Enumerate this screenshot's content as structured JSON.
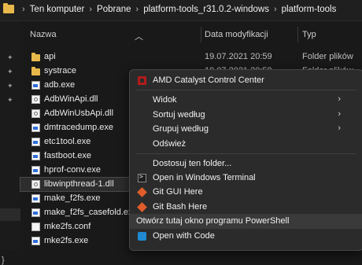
{
  "breadcrumb": [
    "Ten komputer",
    "Pobrane",
    "platform-tools_r31.0.2-windows",
    "platform-tools"
  ],
  "columns": {
    "name": "Nazwa",
    "date": "Data modyfikacji",
    "type": "Typ"
  },
  "files": [
    {
      "name": "api",
      "date": "19.07.2021 20:59",
      "type": "Folder plików",
      "icon": "folder"
    },
    {
      "name": "systrace",
      "date": "19.07.2021 20:59",
      "type": "Folder plików",
      "icon": "folder"
    },
    {
      "name": "adb.exe",
      "date": "",
      "type": "",
      "icon": "exe"
    },
    {
      "name": "AdbWinApi.dll",
      "date": "",
      "type": "apl",
      "icon": "dll"
    },
    {
      "name": "AdbWinUsbApi.dll",
      "date": "",
      "type": "apl",
      "icon": "dll"
    },
    {
      "name": "dmtracedump.exe",
      "date": "",
      "type": "",
      "icon": "exe"
    },
    {
      "name": "etc1tool.exe",
      "date": "",
      "type": "",
      "icon": "exe"
    },
    {
      "name": "fastboot.exe",
      "date": "",
      "type": "",
      "icon": "exe"
    },
    {
      "name": "hprof-conv.exe",
      "date": "",
      "type": "",
      "icon": "exe"
    },
    {
      "name": "libwinpthread-1.dll",
      "date": "",
      "type": "apl",
      "icon": "dll",
      "selected": true
    },
    {
      "name": "make_f2fs.exe",
      "date": "",
      "type": "",
      "icon": "exe"
    },
    {
      "name": "make_f2fs_casefold.exe",
      "date": "",
      "type": "",
      "icon": "exe"
    },
    {
      "name": "mke2fs.conf",
      "date": "",
      "type": "",
      "icon": "conf"
    },
    {
      "name": "mke2fs.exe",
      "date": "",
      "type": "",
      "icon": "exe"
    }
  ],
  "context_menu": {
    "amd": "AMD Catalyst Control Center",
    "view": "Widok",
    "sort": "Sortuj według",
    "group": "Grupuj według",
    "refresh": "Odśwież",
    "customize": "Dostosuj ten folder...",
    "terminal": "Open in Windows Terminal",
    "git_gui": "Git GUI Here",
    "git_bash": "Git Bash Here",
    "powershell": "Otwórz tutaj okno programu PowerShell",
    "vscode": "Open with Code"
  },
  "nav_fragment": "}",
  "overflow_text": "Folder plików"
}
